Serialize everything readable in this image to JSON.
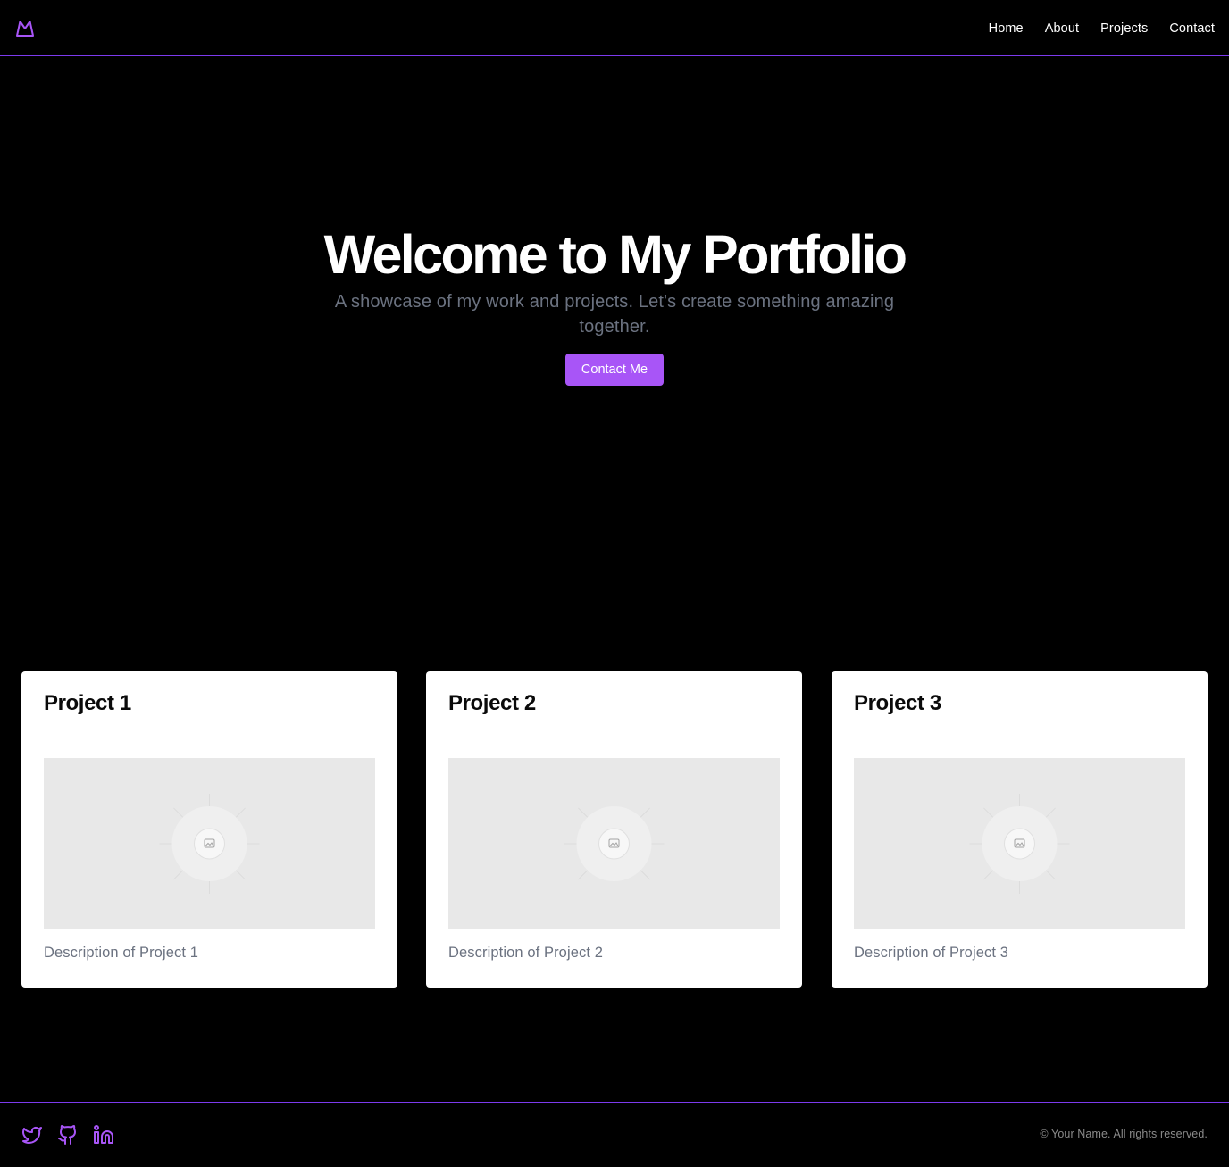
{
  "colors": {
    "background": "#000000",
    "accent": "#a855f7",
    "border_accent": "#7c3aed",
    "muted_text": "#6b7280",
    "card_bg": "#ffffff",
    "placeholder_bg": "#e8e8e8"
  },
  "header": {
    "logo_icon": "mountain-logo-icon",
    "nav": [
      {
        "label": "Home"
      },
      {
        "label": "About"
      },
      {
        "label": "Projects"
      },
      {
        "label": "Contact"
      }
    ]
  },
  "hero": {
    "title": "Welcome to My Portfolio",
    "subtitle": "A showcase of my work and projects. Let's create something amazing together.",
    "cta_label": "Contact Me"
  },
  "projects": [
    {
      "title": "Project 1",
      "description": "Description of Project 1",
      "image_icon": "image-placeholder-icon"
    },
    {
      "title": "Project 2",
      "description": "Description of Project 2",
      "image_icon": "image-placeholder-icon"
    },
    {
      "title": "Project 3",
      "description": "Description of Project 3",
      "image_icon": "image-placeholder-icon"
    }
  ],
  "footer": {
    "socials": [
      {
        "icon": "twitter-icon"
      },
      {
        "icon": "github-icon"
      },
      {
        "icon": "linkedin-icon"
      }
    ],
    "copyright": "© Your Name. All rights reserved."
  }
}
